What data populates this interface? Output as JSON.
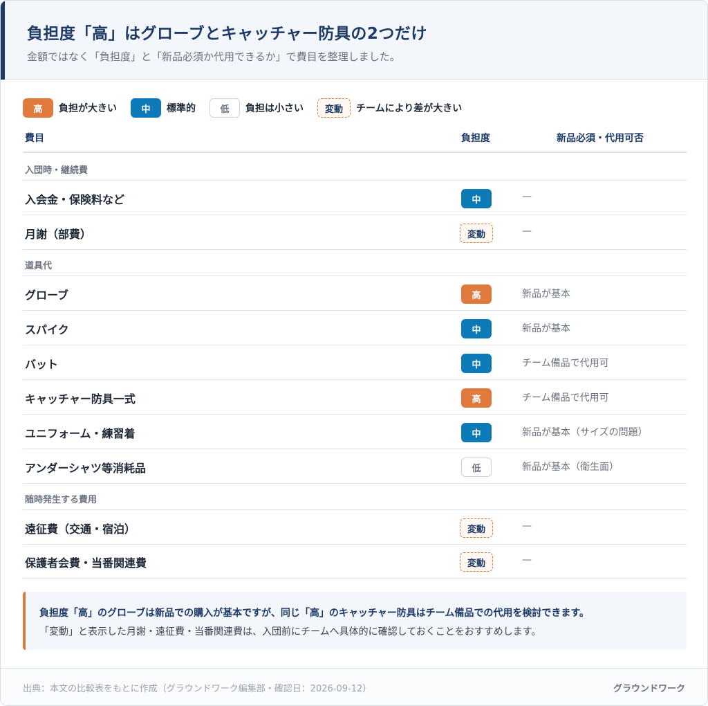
{
  "header": {
    "title": "負担度「高」はグローブとキャッチャー防具の2つだけ",
    "subtitle": "金額ではなく「負担度」と「新品必須か代用できるか」で費目を整理しました。"
  },
  "legend": [
    {
      "badge": "高",
      "label": "負担が大きい",
      "level": "high"
    },
    {
      "badge": "中",
      "label": "標準的",
      "level": "mid"
    },
    {
      "badge": "低",
      "label": "負担は小さい",
      "level": "low"
    },
    {
      "badge": "変動",
      "label": "チームにより差が大きい",
      "level": "var"
    }
  ],
  "table": {
    "headers": {
      "item": "費目",
      "burden": "負担度",
      "new_or_sub": "新品必須・代用可否"
    },
    "sections": [
      {
        "title": "入団時・継続費",
        "rows": [
          {
            "name": "入会金・保険料など",
            "burden": "中",
            "note": "—"
          },
          {
            "name": "月謝（部費）",
            "burden": "変動",
            "note": "—"
          }
        ]
      },
      {
        "title": "道具代",
        "rows": [
          {
            "name": "グローブ",
            "burden": "高",
            "note": "新品が基本"
          },
          {
            "name": "スパイク",
            "burden": "中",
            "note": "新品が基本"
          },
          {
            "name": "バット",
            "burden": "中",
            "note": "チーム備品で代用可"
          },
          {
            "name": "キャッチャー防具一式",
            "burden": "高",
            "note": "チーム備品で代用可"
          },
          {
            "name": "ユニフォーム・練習着",
            "burden": "中",
            "note": "新品が基本（サイズの問題）"
          },
          {
            "name": "アンダーシャツ等消耗品",
            "burden": "低",
            "note": "新品が基本（衛生面）"
          }
        ]
      },
      {
        "title": "随時発生する費用",
        "rows": [
          {
            "name": "遠征費（交通・宿泊）",
            "burden": "変動",
            "note": "—"
          },
          {
            "name": "保護者会費・当番関連費",
            "burden": "変動",
            "note": "—"
          }
        ]
      }
    ]
  },
  "callout": {
    "line1": "負担度「高」のグローブは新品での購入が基本ですが、同じ「高」のキャッチャー防具はチーム備品での代用を検討できます。",
    "line2": "「変動」と表示した月謝・遠征費・当番関連費は、入団前にチームへ具体的に確認しておくことをおすすめします。"
  },
  "footer": {
    "source": "出典：本文の比較表をもとに作成（グラウンドワーク編集部・確認日：2026-09-12）",
    "brand": "グラウンドワーク"
  },
  "colors": {
    "high": "#e07a3c",
    "mid": "#0d7ab8",
    "navy": "#1e3a66"
  }
}
